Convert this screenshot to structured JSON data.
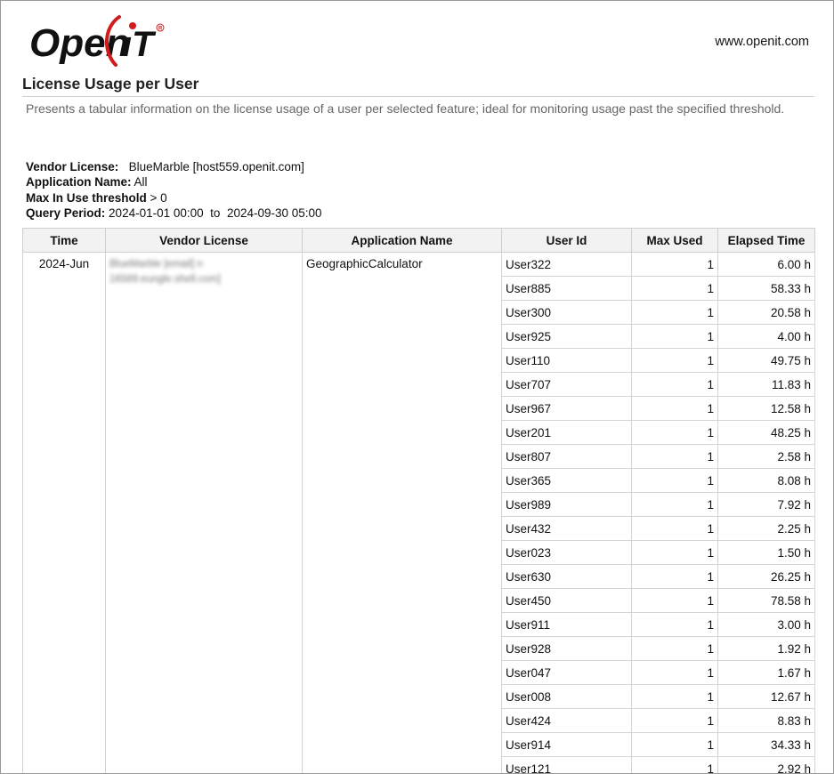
{
  "header": {
    "logo_text": "Open iT",
    "website": "www.openit.com"
  },
  "report": {
    "title": "License Usage per User",
    "description": "Presents a tabular information on the license usage of a user per selected feature; ideal for monitoring usage past the specified threshold."
  },
  "params": {
    "vendor_label": "Vendor License:",
    "vendor_value": "BlueMarble [host559.openit.com]",
    "app_label": "Application Name:",
    "app_value": "All",
    "threshold_label": "Max In Use threshold",
    "threshold_value": "> 0",
    "period_label": "Query Period:",
    "period_from": "2024-01-01 00:00",
    "period_to_word": "to",
    "period_to": "2024-09-30 05:00"
  },
  "table": {
    "headers": [
      "Time",
      "Vendor License",
      "Application Name",
      "User Id",
      "Max Used",
      "Elapsed Time"
    ],
    "group": {
      "time": "2024-Jun",
      "vendor_license": "BlueMarble [email] n 16589.eungle.shell.com]",
      "application": "GeographicCalculator"
    },
    "rows": [
      {
        "user": "User322",
        "max": "1",
        "elapsed": "6.00 h"
      },
      {
        "user": "User885",
        "max": "1",
        "elapsed": "58.33 h"
      },
      {
        "user": "User300",
        "max": "1",
        "elapsed": "20.58 h"
      },
      {
        "user": "User925",
        "max": "1",
        "elapsed": "4.00 h"
      },
      {
        "user": "User110",
        "max": "1",
        "elapsed": "49.75 h"
      },
      {
        "user": "User707",
        "max": "1",
        "elapsed": "11.83 h"
      },
      {
        "user": "User967",
        "max": "1",
        "elapsed": "12.58 h"
      },
      {
        "user": "User201",
        "max": "1",
        "elapsed": "48.25 h"
      },
      {
        "user": "User807",
        "max": "1",
        "elapsed": "2.58 h"
      },
      {
        "user": "User365",
        "max": "1",
        "elapsed": "8.08 h"
      },
      {
        "user": "User989",
        "max": "1",
        "elapsed": "7.92 h"
      },
      {
        "user": "User432",
        "max": "1",
        "elapsed": "2.25 h"
      },
      {
        "user": "User023",
        "max": "1",
        "elapsed": "1.50 h"
      },
      {
        "user": "User630",
        "max": "1",
        "elapsed": "26.25 h"
      },
      {
        "user": "User450",
        "max": "1",
        "elapsed": "78.58 h"
      },
      {
        "user": "User911",
        "max": "1",
        "elapsed": "3.00 h"
      },
      {
        "user": "User928",
        "max": "1",
        "elapsed": "1.92 h"
      },
      {
        "user": "User047",
        "max": "1",
        "elapsed": "1.67 h"
      },
      {
        "user": "User008",
        "max": "1",
        "elapsed": "12.67 h"
      },
      {
        "user": "User424",
        "max": "1",
        "elapsed": "8.83 h"
      },
      {
        "user": "User914",
        "max": "1",
        "elapsed": "34.33 h"
      },
      {
        "user": "User121",
        "max": "1",
        "elapsed": "2.92 h"
      }
    ]
  }
}
